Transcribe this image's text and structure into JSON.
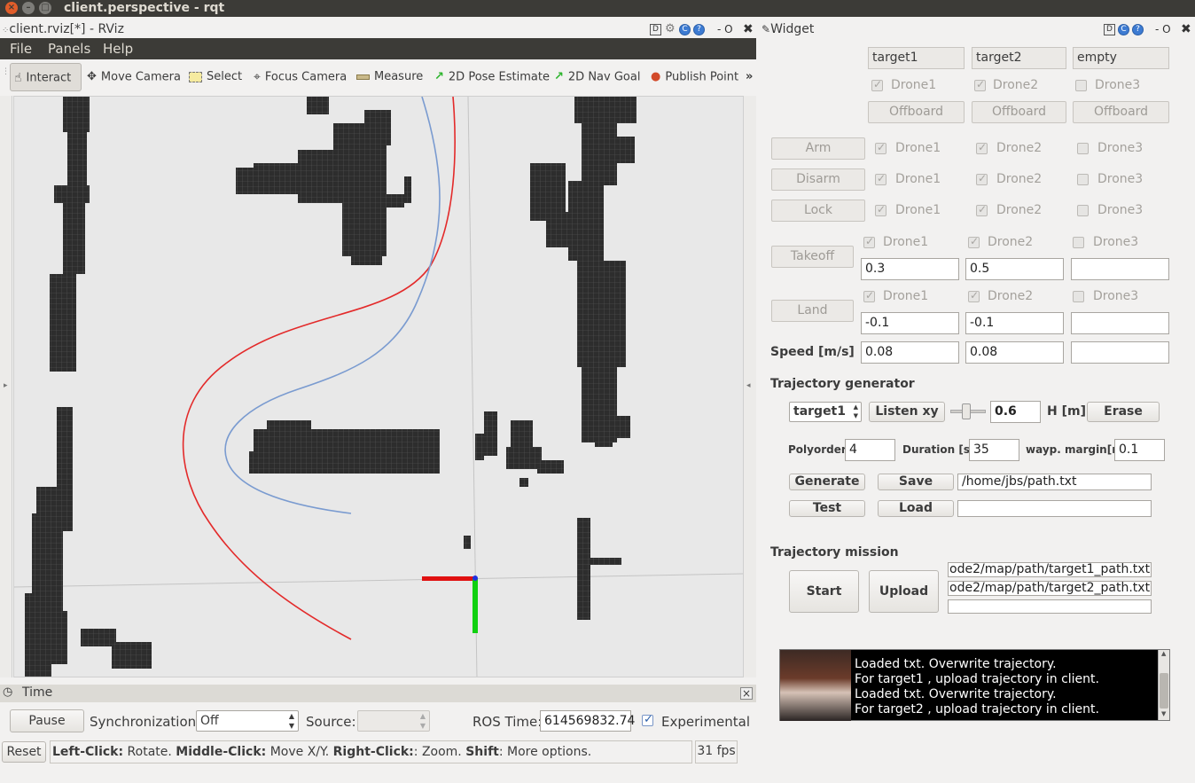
{
  "window": {
    "title": "client.perspective - rqt"
  },
  "rviz": {
    "dock_title": "client.rviz[*] - RViz",
    "dock_buttons": [
      "D",
      "?",
      "- O",
      "✖"
    ],
    "menu": [
      "File",
      "Panels",
      "Help"
    ],
    "tools": [
      "Interact",
      "Move Camera",
      "Select",
      "Focus Camera",
      "Measure",
      "2D Pose Estimate",
      "2D Nav Goal",
      "Publish Point"
    ],
    "more": "»"
  },
  "time_panel": {
    "title": "Time",
    "close": "×",
    "pause_label": "Pause",
    "sync_label": "Synchronization:",
    "sync_value": "Off",
    "source_label": "Source:",
    "source_value": "",
    "ros_time_label": "ROS Time:",
    "ros_time_value": "614569832.74",
    "experimental_label": "Experimental",
    "experimental_checked": true
  },
  "status": {
    "reset_label": "Reset",
    "hint_left_click": "Left-Click:",
    "hint_rotate": " Rotate. ",
    "hint_middle_click": "Middle-Click:",
    "hint_move": " Move X/Y. ",
    "hint_right_click": "Right-Click:",
    "hint_zoom": ": Zoom. ",
    "hint_shift": "Shift",
    "hint_more": ": More options.",
    "fps": "31 fps"
  },
  "widget": {
    "dock_title": "Widget",
    "dock_buttons": [
      "D",
      "?",
      "- O",
      "✖"
    ],
    "targets": [
      "target1",
      "target2",
      "empty"
    ],
    "drones": [
      "Drone1",
      "Drone2",
      "Drone3"
    ],
    "drone_checked": [
      true,
      true,
      false
    ],
    "offboard_label": "Offboard",
    "arm_label": "Arm",
    "disarm_label": "Disarm",
    "lock_label": "Lock",
    "takeoff_label": "Takeoff",
    "takeoff_values": [
      "0.3",
      "0.5",
      ""
    ],
    "land_label": "Land",
    "land_values": [
      "-0.1",
      "-0.1",
      ""
    ],
    "speed_label": "Speed [m/s]",
    "speed_values": [
      "0.08",
      "0.08",
      ""
    ],
    "traj_gen_title": "Trajectory generator",
    "target_select": "target1",
    "listen_label": "Listen xy",
    "height_value": "0.6",
    "height_label": "H [m]",
    "erase_label": "Erase",
    "polyorder_label": "Polyorder",
    "polyorder_value": "4",
    "duration_label": "Duration [s]",
    "duration_value": "35",
    "margin_label": "wayp. margin[m]",
    "margin_value": "0.1",
    "generate_label": "Generate",
    "save_label": "Save",
    "save_path": "/home/jbs/path.txt",
    "test_label": "Test",
    "load_label": "Load",
    "load_path": "",
    "mission_title": "Trajectory mission",
    "start_label": "Start",
    "upload_label": "Upload",
    "mission_paths": [
      "ode2/map/path/target1_path.txt",
      "ode2/map/path/target2_path.txt",
      ""
    ],
    "console_lines": "Loaded txt. Overwrite trajectory.\nFor target1 , upload trajectory in client.\nLoaded txt. Overwrite trajectory.\nFor target2 , upload trajectory in client."
  },
  "colors": {
    "titlebar": "#3c3b37",
    "close_button": "#e05d2a",
    "trajectory_red": "#e32a2a",
    "trajectory_blue": "#7a9bd0",
    "occupied_cells": "#2d2d2d",
    "axis_x": "#e01010",
    "axis_y": "#10d010"
  }
}
